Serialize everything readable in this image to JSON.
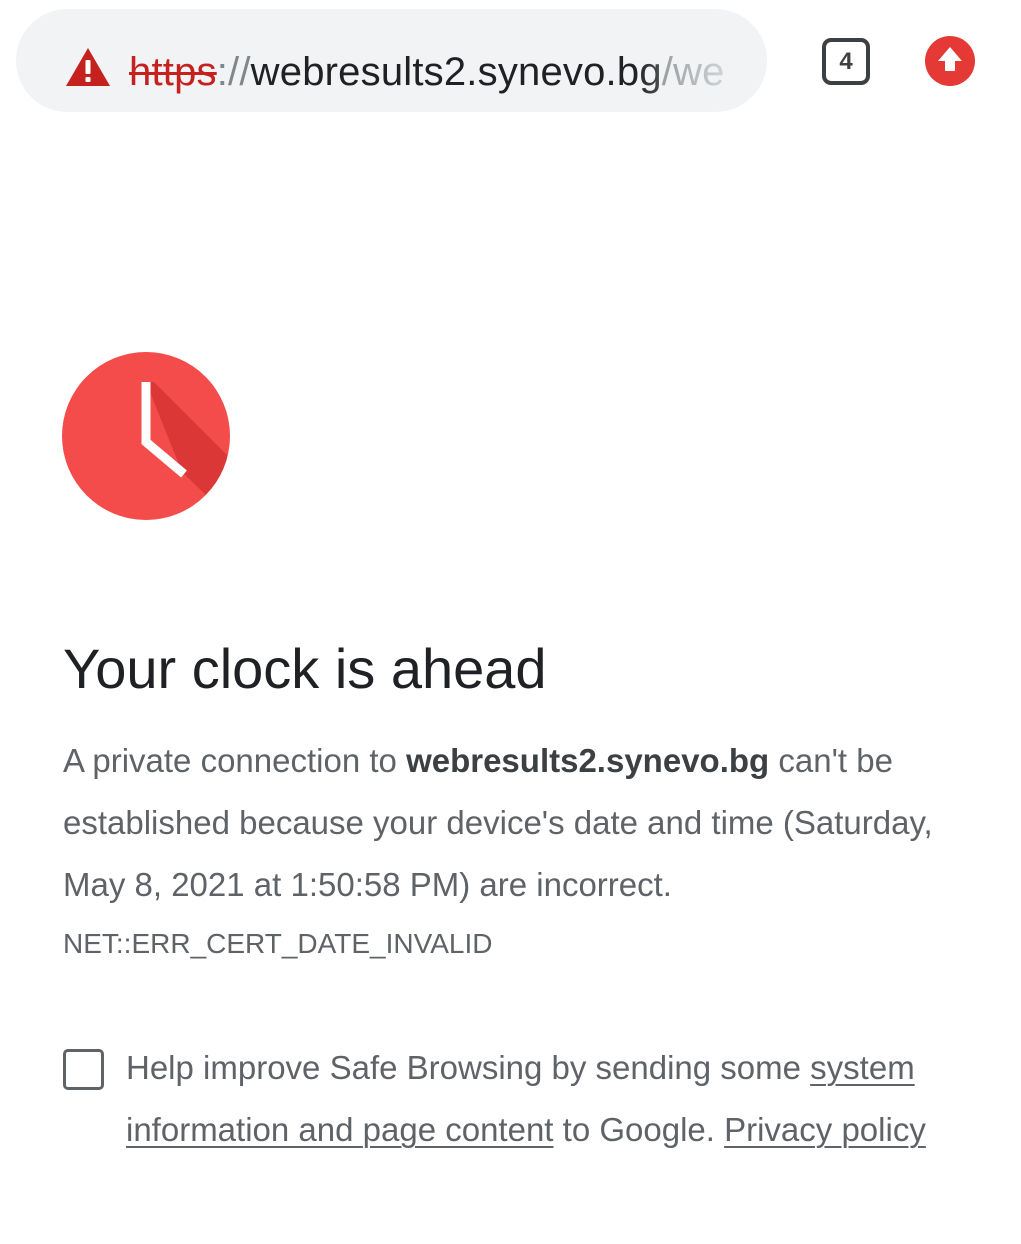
{
  "toolbar": {
    "url": {
      "scheme": "https",
      "separator": "://",
      "host": "webresults2.synevo.bg",
      "path": "/we"
    },
    "tab_count": "4",
    "icons": {
      "security": "warning-triangle-icon",
      "update": "update-arrow-icon"
    }
  },
  "interstitial": {
    "icon": "clock-icon",
    "title": "Your clock is ahead",
    "body_prefix": "A private connection to ",
    "body_host": "webresults2.synevo.bg",
    "body_suffix": " can't be established because your device's date and time (Saturday, May 8, 2021 at 1:50:58 PM) are incorrect.",
    "error_code": "NET::ERR_CERT_DATE_INVALID",
    "safe_browsing": {
      "checked": false,
      "text_prefix": "Help improve Safe Browsing by sending some ",
      "link1": "system information and page content",
      "text_middle": " to Google. ",
      "link2": "Privacy policy"
    }
  },
  "colors": {
    "warning_red": "#c5221f",
    "clock_red": "#f44b4b",
    "update_red": "#e53935",
    "omnibox_bg": "#f1f3f4"
  }
}
